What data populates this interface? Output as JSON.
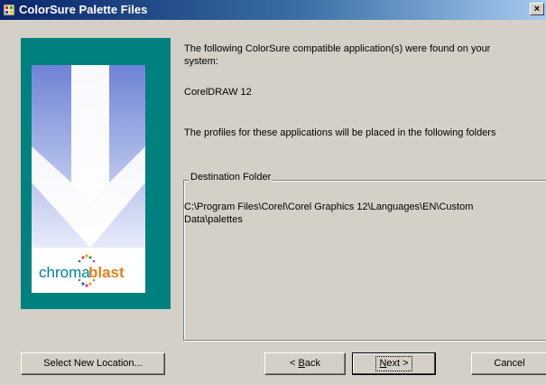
{
  "window": {
    "title": "ColorSure Palette Files",
    "close_glyph": "×"
  },
  "banner": {
    "logo_text_left": "chroma",
    "logo_text_right": "blast",
    "colors": {
      "frame": "#00807f",
      "sky_top": "#6f83d6",
      "sky_bottom": "#e8ecfa"
    }
  },
  "main": {
    "found_line1": "The following ColorSure compatible application(s) were found on your",
    "found_line2": "system:",
    "app_name": "CorelDRAW 12",
    "profiles_text": "The profiles for these applications will be placed in the following folders",
    "destination": {
      "legend": "Destination Folder",
      "path_line1": "C:\\Program Files\\Corel\\Corel Graphics 12\\Languages\\EN\\Custom",
      "path_line2": "Data\\palettes"
    }
  },
  "buttons": {
    "select_location": "Select New Location...",
    "back_prefix": "< ",
    "back_key": "B",
    "back_rest": "ack",
    "next_key": "N",
    "next_rest": "ext >",
    "cancel": "Cancel"
  }
}
